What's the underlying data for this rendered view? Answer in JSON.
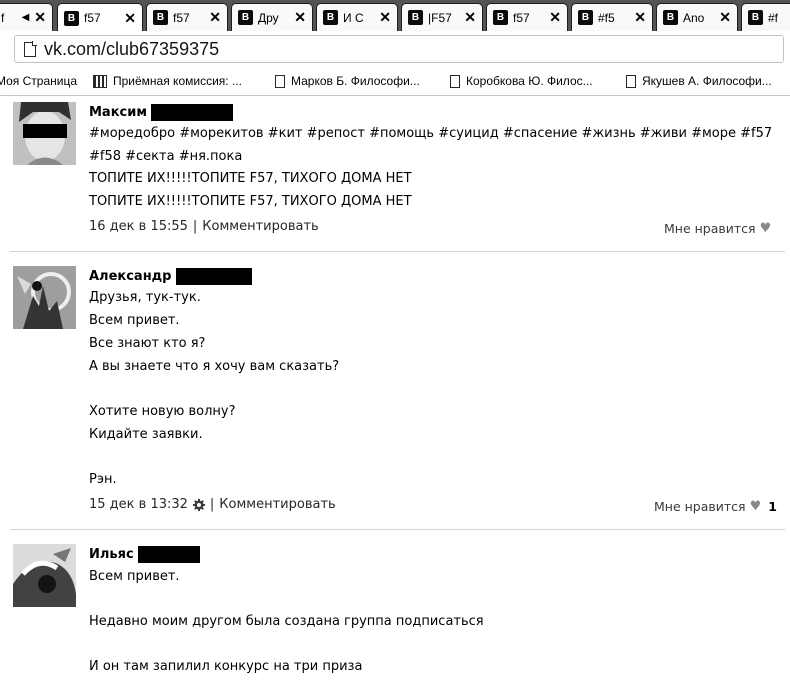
{
  "browser": {
    "tabs": [
      {
        "title": "f",
        "has_logo": false,
        "leading": "◀"
      },
      {
        "title": "f57",
        "has_logo": true
      },
      {
        "title": "f57",
        "has_logo": true
      },
      {
        "title": "Дру",
        "has_logo": true
      },
      {
        "title": "И С",
        "has_logo": true
      },
      {
        "title": "|F57",
        "has_logo": true
      },
      {
        "title": "f57",
        "has_logo": true
      },
      {
        "title": "#f5",
        "has_logo": true
      },
      {
        "title": "Ano",
        "has_logo": true
      },
      {
        "title": "#f",
        "has_logo": true
      }
    ],
    "logo_letter": "B",
    "close_glyph": "✕",
    "url": "vk.com/club67359375",
    "bookmarks": [
      {
        "label": "Моя Страница",
        "icon": "none"
      },
      {
        "label": "Приёмная комиссия: ...",
        "icon": "grid-icon"
      },
      {
        "label": "Марков Б. Философи...",
        "icon": "page-icon"
      },
      {
        "label": "Коробкова Ю. Филос...",
        "icon": "page-icon"
      },
      {
        "label": "Якушев А. Философи...",
        "icon": "page-icon"
      }
    ]
  },
  "posts": [
    {
      "author": "Максим",
      "lines": [
        "#моредобро #морекитов #кит #репост #помощь #суицид #спасение #жизнь #живи #море #f57",
        "#f58 #секта #ня.пока",
        "ТОПИТЕ ИХ!!!!!ТОПИТЕ F57, ТИХОГО ДОМА НЕТ",
        "ТОПИТЕ ИХ!!!!!ТОПИТЕ F57, ТИХОГО ДОМА НЕТ"
      ],
      "date": "16 дек в 15:55",
      "comment_label": "Комментировать",
      "like_label": "Мне нравится",
      "like_count": ""
    },
    {
      "author": "Александр",
      "lines": [
        "Друзья, тук-тук.",
        "Всем привет.",
        "Все знают кто я?",
        "А вы знаете что я хочу вам сказать?",
        "",
        "Хотите новую волну?",
        "Кидайте заявки.",
        "",
        "Рэн."
      ],
      "date": "15 дек в 13:32",
      "comment_label": "Комментировать",
      "like_label": "Мне нравится",
      "like_count": "1"
    },
    {
      "author": "Ильяс",
      "lines": [
        "Всем привет.",
        "",
        "Недавно моим другом была создана группа подписаться",
        "",
        "И он там запилил конкурс на три приза"
      ]
    }
  ],
  "separator": "|"
}
